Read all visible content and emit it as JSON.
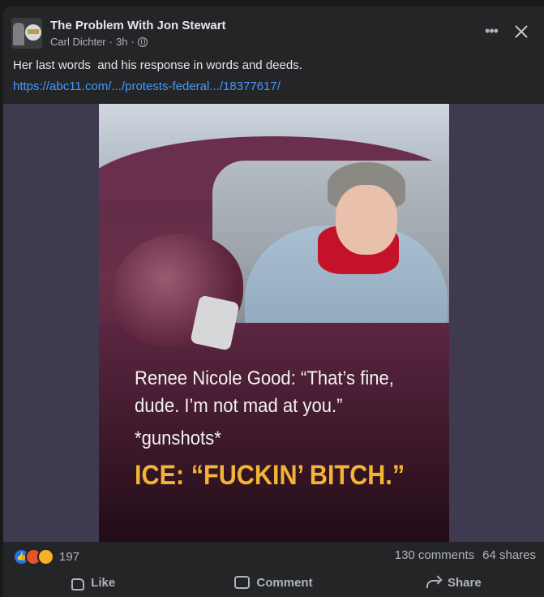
{
  "post": {
    "group_name": "The Problem With Jon Stewart",
    "author": "Carl Dichter",
    "time": "3h",
    "privacy_icon": "globe-icon",
    "text": "Her last words  and his response in words and deeds.",
    "link": "https://abc11.com/.../protests-federal.../18377617/"
  },
  "header": {
    "more_label": "•••",
    "more_icon": "more-options-icon",
    "close_icon": "close-icon"
  },
  "image": {
    "caption_line1": "Renee Nicole Good: “That’s fine,",
    "caption_line2": "dude. I’m not mad at you.”",
    "caption_line3": "*gunshots*",
    "caption_ice": "ICE: “FUCKIN’ BITCH.”"
  },
  "stats": {
    "reaction_count": "197",
    "comments": "130 comments",
    "shares": "64 shares",
    "reactions": [
      "like-icon",
      "angry-icon",
      "sad-icon"
    ]
  },
  "actions": {
    "like": "Like",
    "comment": "Comment",
    "share": "Share"
  },
  "colors": {
    "background": "#242526",
    "link": "#4599ff",
    "caption_highlight": "#f3b335",
    "like_blue": "#1877f2"
  }
}
